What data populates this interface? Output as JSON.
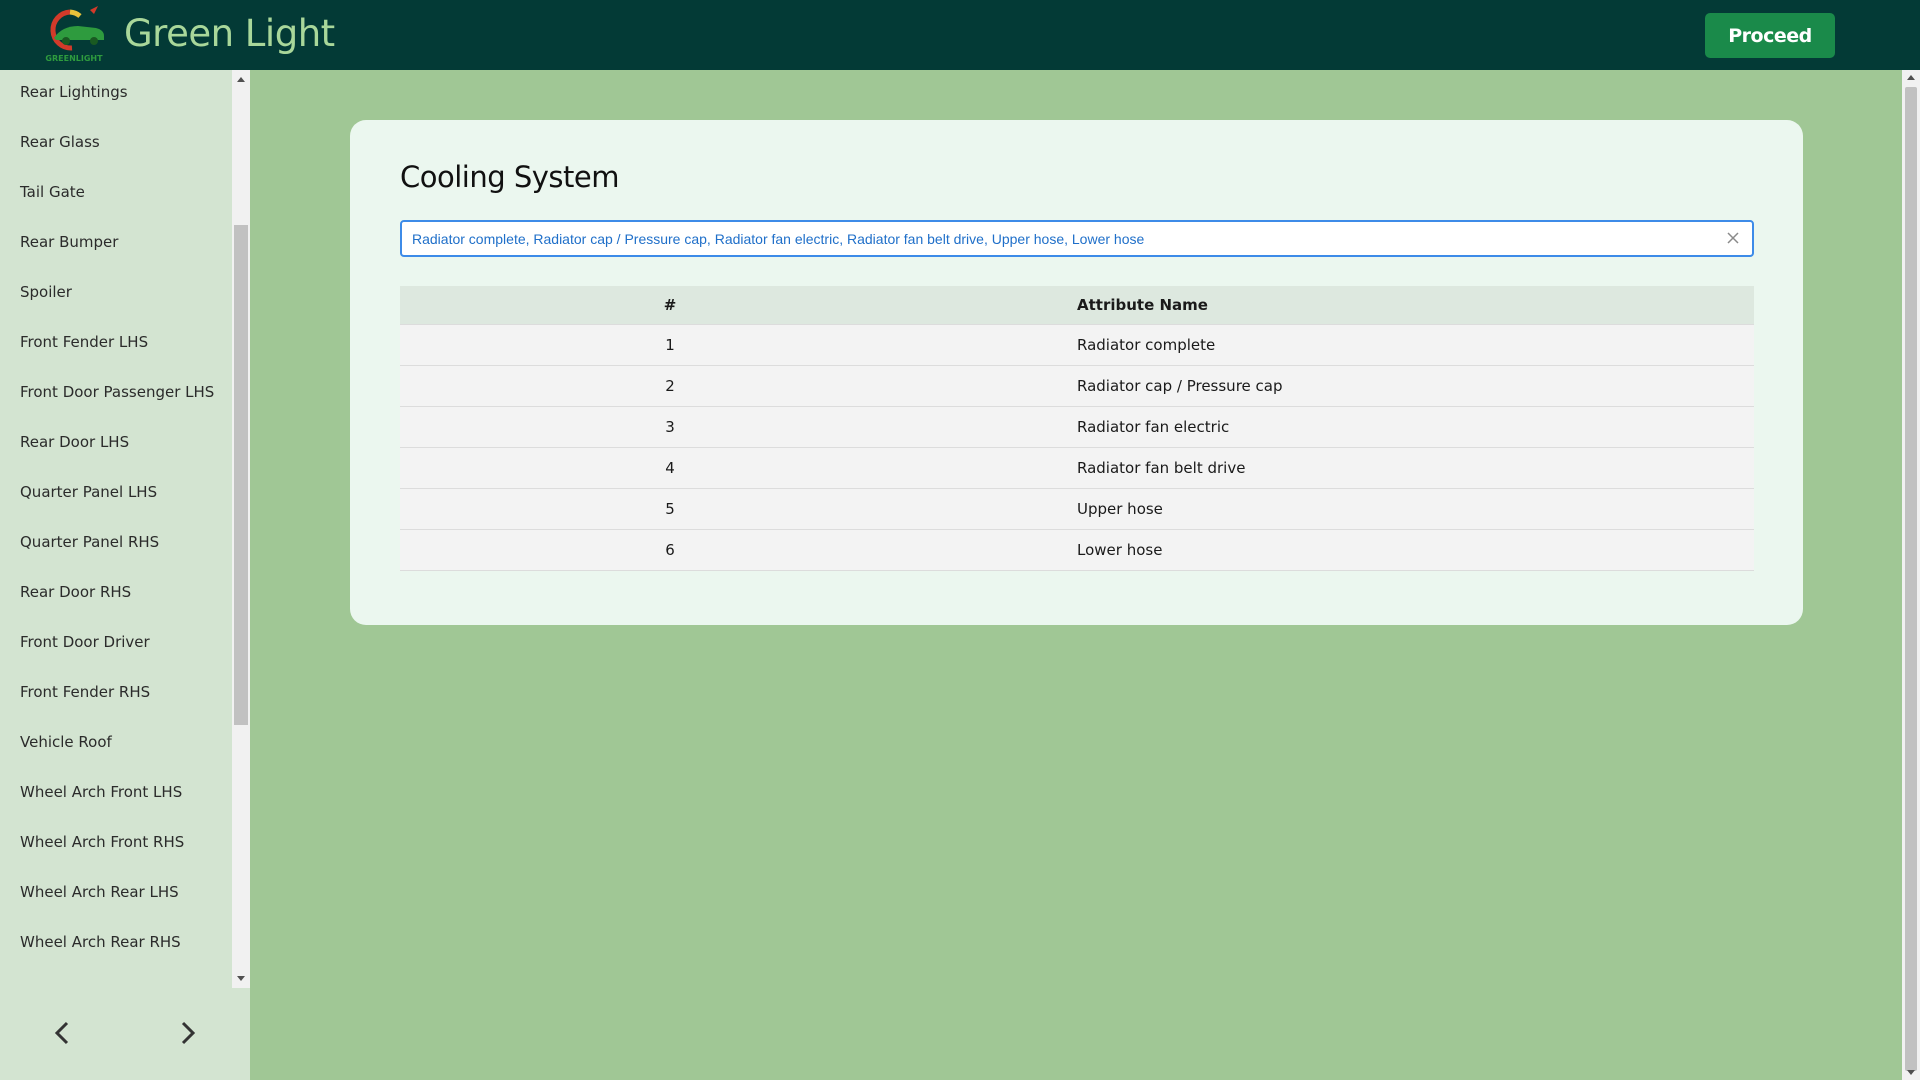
{
  "header": {
    "brand": "Green Light",
    "logo_text": "GREENLIGHT",
    "proceed_label": "Proceed"
  },
  "sidebar": {
    "items": [
      {
        "label": "Rear Lightings"
      },
      {
        "label": "Rear Glass"
      },
      {
        "label": "Tail Gate"
      },
      {
        "label": "Rear Bumper"
      },
      {
        "label": "Spoiler"
      },
      {
        "label": "Front Fender LHS"
      },
      {
        "label": "Front Door Passenger LHS"
      },
      {
        "label": "Rear Door LHS"
      },
      {
        "label": "Quarter Panel LHS"
      },
      {
        "label": "Quarter Panel RHS"
      },
      {
        "label": "Rear Door RHS"
      },
      {
        "label": "Front Door Driver"
      },
      {
        "label": "Front Fender RHS"
      },
      {
        "label": "Vehicle Roof"
      },
      {
        "label": "Wheel Arch Front LHS"
      },
      {
        "label": "Wheel Arch Front RHS"
      },
      {
        "label": "Wheel Arch Rear LHS"
      },
      {
        "label": "Wheel Arch Rear RHS"
      }
    ]
  },
  "main": {
    "title": "Cooling System",
    "selection_text": "Radiator complete, Radiator cap / Pressure cap, Radiator fan electric, Radiator fan belt drive, Upper hose, Lower hose",
    "table": {
      "headers": [
        "#",
        "Attribute Name"
      ],
      "rows": [
        {
          "num": "1",
          "name": "Radiator complete"
        },
        {
          "num": "2",
          "name": "Radiator cap / Pressure cap"
        },
        {
          "num": "3",
          "name": "Radiator fan electric"
        },
        {
          "num": "4",
          "name": "Radiator fan belt drive"
        },
        {
          "num": "5",
          "name": "Upper hose"
        },
        {
          "num": "6",
          "name": "Lower hose"
        }
      ]
    }
  },
  "colors": {
    "header_bg": "#033a36",
    "brand_text": "#a9d79a",
    "page_bg": "#a0c795",
    "sidebar_bg": "#d3e4d1",
    "proceed_bg": "#1a8a4a",
    "card_bg": "#ebf7ef",
    "select_border": "#3d8be8",
    "select_text": "#1f6fc9"
  },
  "icons": {
    "prev": "chevron-left-icon",
    "next": "chevron-right-icon",
    "clear": "close-icon"
  }
}
